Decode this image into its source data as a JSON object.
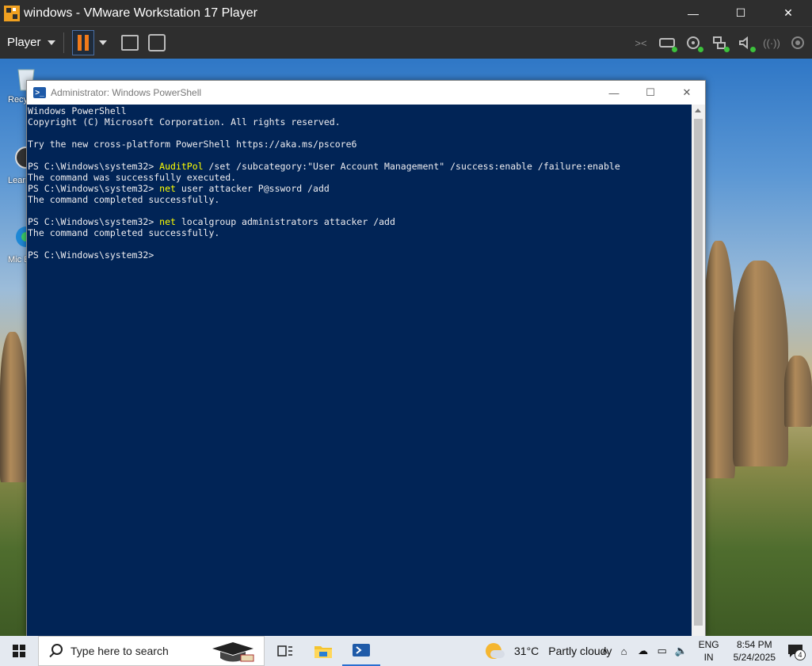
{
  "vmware": {
    "title": "windows - VMware Workstation 17 Player",
    "player_menu": "Player",
    "minimize": "—",
    "maximize": "☐",
    "close": "✕"
  },
  "desktop": {
    "icons": [
      {
        "label": "Recy"
      },
      {
        "label": "Learn this"
      },
      {
        "label": "Mic Ed"
      }
    ]
  },
  "powershell": {
    "title": "Administrator: Windows PowerShell",
    "lines": [
      {
        "prompt": "",
        "cmd": "",
        "rest": "Windows PowerShell"
      },
      {
        "prompt": "",
        "cmd": "",
        "rest": "Copyright (C) Microsoft Corporation. All rights reserved."
      },
      {
        "prompt": "",
        "cmd": "",
        "rest": ""
      },
      {
        "prompt": "",
        "cmd": "",
        "rest": "Try the new cross-platform PowerShell https://aka.ms/pscore6"
      },
      {
        "prompt": "",
        "cmd": "",
        "rest": ""
      },
      {
        "prompt": "PS C:\\Windows\\system32> ",
        "cmd": "AuditPol",
        "rest": " /set /subcategory:\"User Account Management\" /success:enable /failure:enable"
      },
      {
        "prompt": "",
        "cmd": "",
        "rest": "The command was successfully executed."
      },
      {
        "prompt": "PS C:\\Windows\\system32> ",
        "cmd": "net",
        "rest": " user attacker P@ssword /add"
      },
      {
        "prompt": "",
        "cmd": "",
        "rest": "The command completed successfully."
      },
      {
        "prompt": "",
        "cmd": "",
        "rest": ""
      },
      {
        "prompt": "PS C:\\Windows\\system32> ",
        "cmd": "net",
        "rest": " localgroup administrators attacker /add"
      },
      {
        "prompt": "",
        "cmd": "",
        "rest": "The command completed successfully."
      },
      {
        "prompt": "",
        "cmd": "",
        "rest": ""
      },
      {
        "prompt": "PS C:\\Windows\\system32> ",
        "cmd": "",
        "rest": ""
      }
    ],
    "colors": {
      "background": "#012456",
      "text": "#eeedf0",
      "command": "#ffff00"
    }
  },
  "taskbar": {
    "search_placeholder": "Type here to search",
    "weather_temp": "31°C",
    "weather_desc": "Partly cloudy",
    "lang_top": "ENG",
    "lang_bottom": "IN",
    "time": "8:54 PM",
    "date": "5/24/2025",
    "notification_count": "4"
  }
}
